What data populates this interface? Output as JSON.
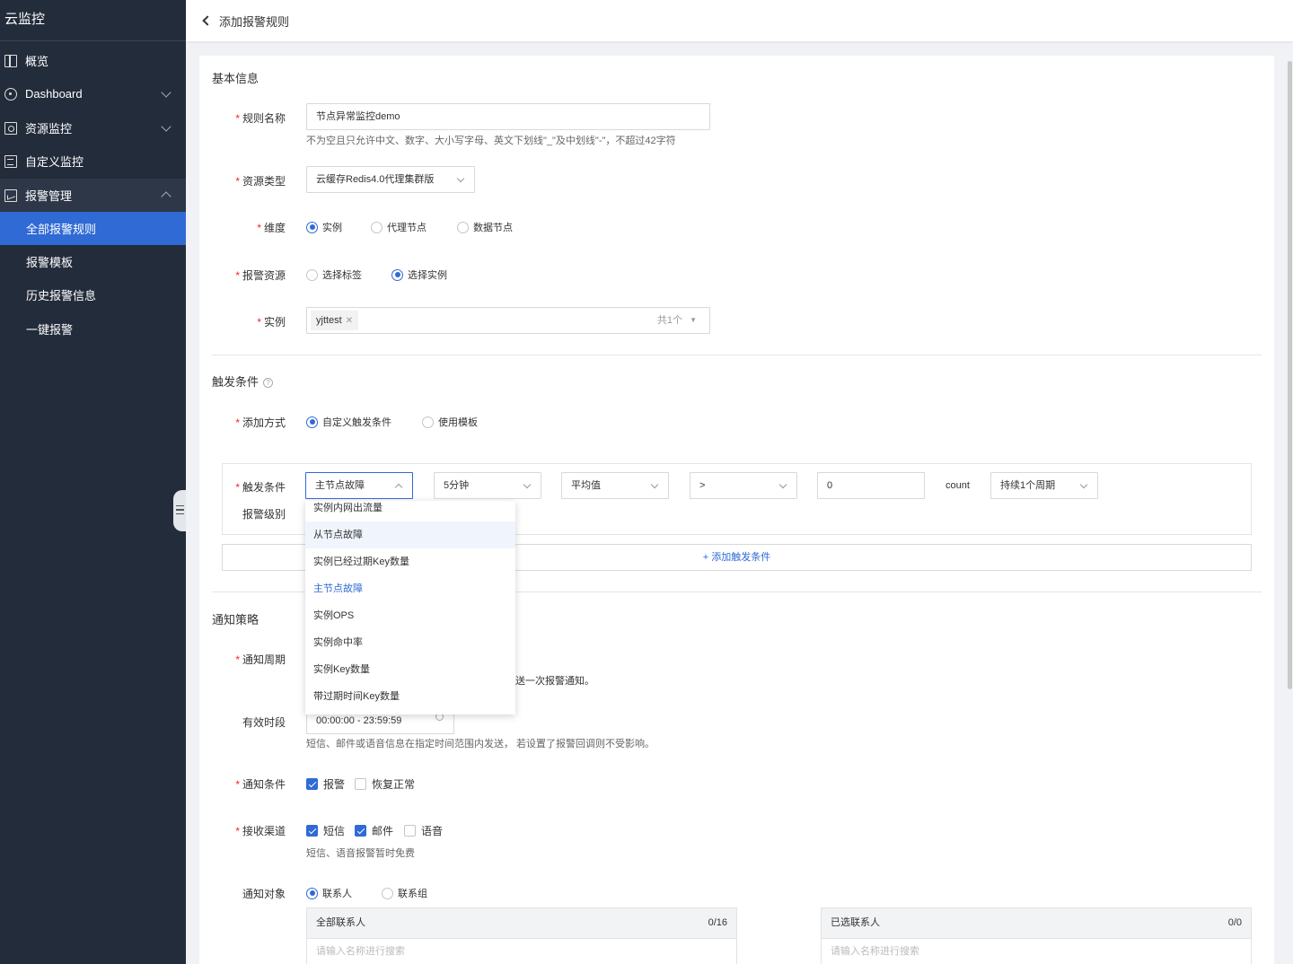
{
  "sidebar": {
    "brand": "云监控",
    "items": [
      {
        "label": "概览",
        "icon": "overview-grid-icon"
      },
      {
        "label": "Dashboard",
        "icon": "dashboard-icon"
      },
      {
        "label": "资源监控",
        "icon": "resource-monitor-icon"
      },
      {
        "label": "自定义监控",
        "icon": "custom-monitor-icon"
      },
      {
        "label": "报警管理",
        "icon": "alarm-management-icon"
      }
    ],
    "sub_items": [
      "全部报警规则",
      "报警模板",
      "历史报警信息",
      "一键报警"
    ]
  },
  "header": {
    "title": "添加报警规则"
  },
  "basic": {
    "title": "基本信息",
    "rule_name_label": "规则名称",
    "rule_name_value": "节点异常监控demo",
    "rule_name_hint": "不为空且只允许中文、数字、大小写字母、英文下划线\"_\"及中划线\"-\"，不超过42字符",
    "resource_type_label": "资源类型",
    "resource_type_value": "云缓存Redis4.0代理集群版",
    "dimension_label": "维度",
    "dimension_options": [
      "实例",
      "代理节点",
      "数据节点"
    ],
    "alarm_resource_label": "报警资源",
    "alarm_resource_options": [
      "选择标签",
      "选择实例"
    ],
    "instance_label": "实例",
    "instance_tag": "yjttest",
    "instance_count": "共1个"
  },
  "trigger": {
    "title": "触发条件",
    "add_method_label": "添加方式",
    "add_method_options": [
      "自定义触发条件",
      "使用模板"
    ],
    "condition_label": "触发条件",
    "level_label": "报警级别",
    "metric_value": "主节点故障",
    "period_value": "5分钟",
    "stat_value": "平均值",
    "operator_value": ">",
    "threshold_value": "0",
    "unit": "count",
    "duration_value": "持续1个周期",
    "add_condition": "+ 添加触发条件",
    "dropdown_items": [
      "实例内网出流量",
      "从节点故障",
      "实例已经过期Key数量",
      "主节点故障",
      "实例OPS",
      "实例命中率",
      "实例Key数量",
      "带过期时间Key数量"
    ]
  },
  "notify": {
    "title": "通知策略",
    "cycle_label": "通知周期",
    "cycle_hint_tail": "送一次报警通知。",
    "valid_period_label": "有效时段",
    "valid_period_value": "00:00:00 - 23:59:59",
    "valid_period_hint": "短信、邮件或语音信息在指定时间范围内发送， 若设置了报警回调则不受影响。",
    "condition_label": "通知条件",
    "condition_options": [
      "报警",
      "恢复正常"
    ],
    "channel_label": "接收渠道",
    "channel_options": [
      "短信",
      "邮件",
      "语音"
    ],
    "channel_hint": "短信、语音报警暂时免费",
    "target_label": "通知对象",
    "target_options": [
      "联系人",
      "联系组"
    ],
    "all_contacts_title": "全部联系人",
    "all_contacts_count": "0/16",
    "selected_contacts_title": "已选联系人",
    "selected_contacts_count": "0/0",
    "search_placeholder": "请输入名称进行搜索"
  },
  "colors": {
    "accent": "#2f6ad5",
    "sidebar_bg": "#232c3b",
    "required": "#f5222d"
  }
}
